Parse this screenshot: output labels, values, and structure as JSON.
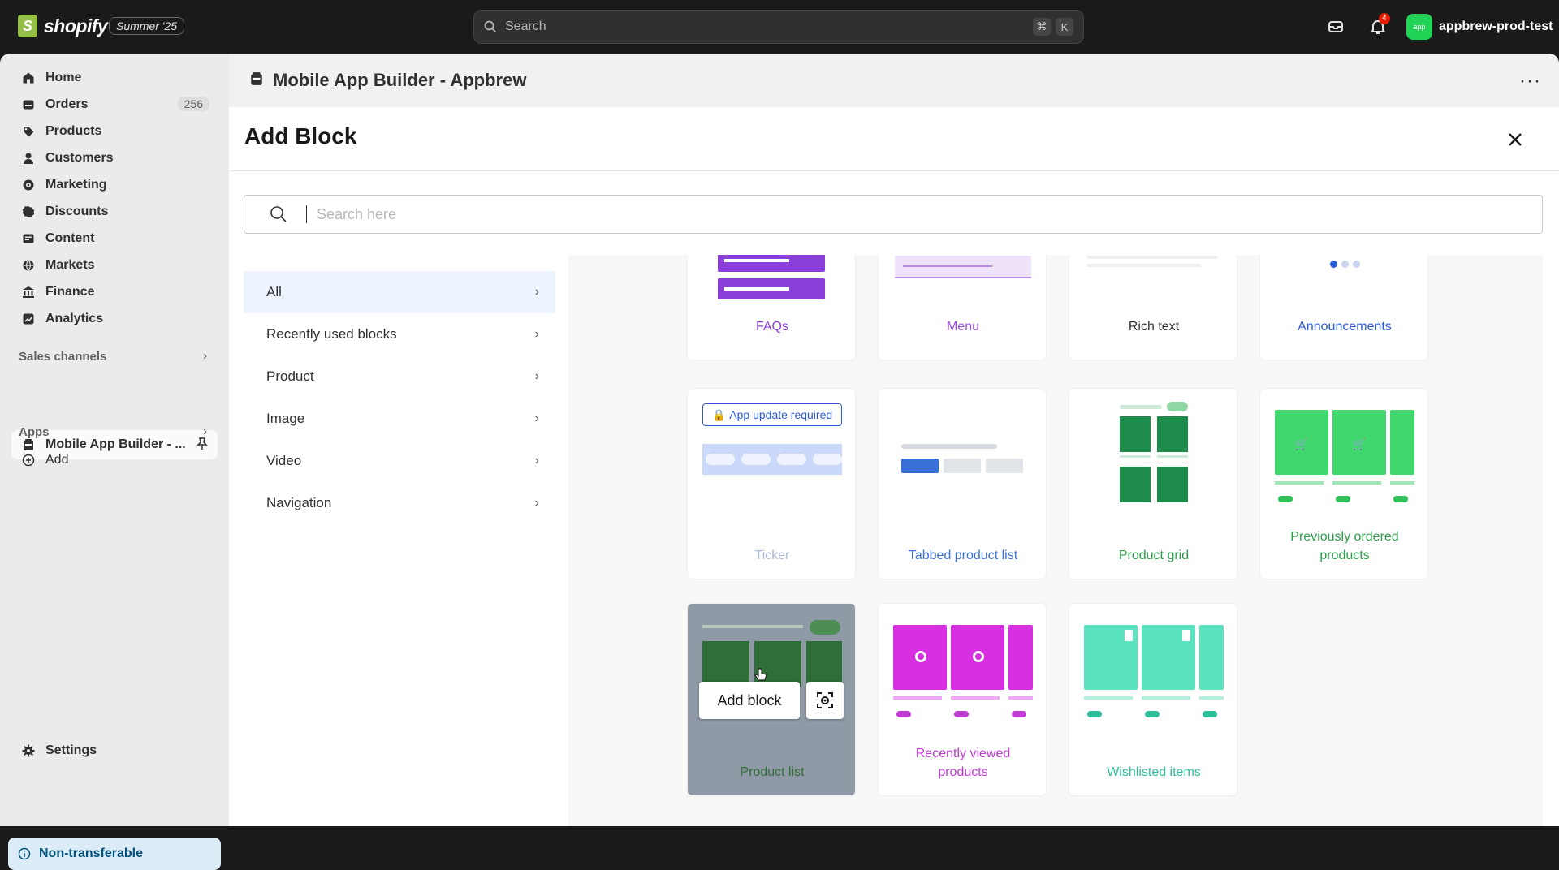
{
  "topbar": {
    "logo_text": "shopify",
    "edition": "Summer '25",
    "search_placeholder": "Search",
    "kbd_cmd": "⌘",
    "kbd_k": "K",
    "notifications_count": "4",
    "store_initials": "app",
    "store_name": "appbrew-prod-test"
  },
  "sidebar": {
    "items": [
      {
        "label": "Home",
        "icon": "home-icon"
      },
      {
        "label": "Orders",
        "icon": "orders-icon",
        "count": "256"
      },
      {
        "label": "Products",
        "icon": "tag-icon"
      },
      {
        "label": "Customers",
        "icon": "person-icon"
      },
      {
        "label": "Marketing",
        "icon": "target-icon"
      },
      {
        "label": "Discounts",
        "icon": "discount-icon"
      },
      {
        "label": "Content",
        "icon": "content-icon"
      },
      {
        "label": "Markets",
        "icon": "globe-icon"
      },
      {
        "label": "Finance",
        "icon": "bank-icon"
      },
      {
        "label": "Analytics",
        "icon": "chart-icon"
      }
    ],
    "sales_channels_label": "Sales channels",
    "channel_label": "Mobile App Builder - ...",
    "apps_label": "Apps",
    "add_label": "Add",
    "settings_label": "Settings",
    "non_transferable_label": "Non-transferable"
  },
  "app": {
    "title": "Mobile App Builder - Appbrew"
  },
  "panel": {
    "title": "Add Block",
    "search_placeholder": "Search here",
    "categories": [
      "All",
      "Recently used blocks",
      "Product",
      "Image",
      "Video",
      "Navigation"
    ],
    "active_category": "All"
  },
  "tiles": {
    "faqs": "FAQs",
    "menu": "Menu",
    "rich_text": "Rich text",
    "announcements": "Announcements",
    "ticker_badge": "App update required",
    "ticker": "Ticker",
    "tabbed": "Tabbed product list",
    "grid": "Product grid",
    "prev_ordered": "Previously ordered products",
    "product_list": "Product list",
    "recently_viewed": "Recently viewed products",
    "wishlisted": "Wishlisted items",
    "add_block_button": "Add block"
  },
  "colors": {
    "faqs": "#8b3fd9",
    "menu": "#9b4fe0",
    "announcements": "#2c5bd6",
    "ticker": "#a9b9d6",
    "tabbed": "#3a6fd8",
    "green": "#2a9d4a",
    "magenta": "#c23ad6",
    "teal": "#2fbf9a"
  }
}
